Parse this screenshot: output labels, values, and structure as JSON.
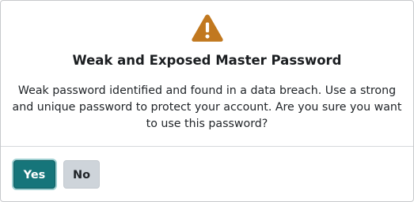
{
  "dialog": {
    "icon": "warning-triangle-icon",
    "title": "Weak and Exposed Master Password",
    "message": "Weak password identified and found in a data breach. Use a strong and unique password to protect your account. Are you sure you want to use this password?",
    "buttons": {
      "yes_label": "Yes",
      "no_label": "No"
    }
  },
  "colors": {
    "warning": "#c1781f",
    "primary_button": "#16757a",
    "secondary_button": "#ced4da",
    "border": "#c7c9cc"
  }
}
